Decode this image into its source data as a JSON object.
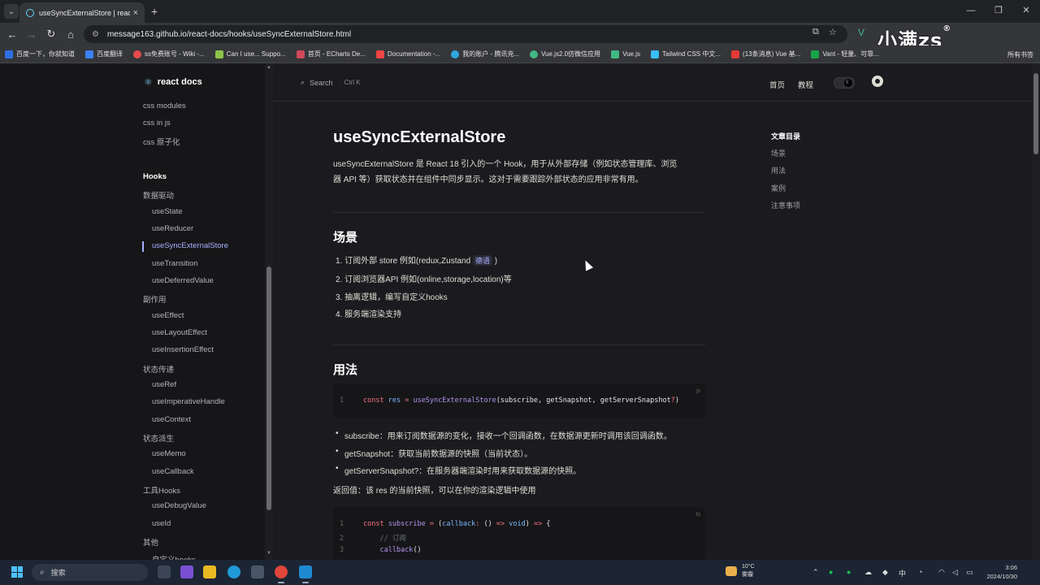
{
  "browser": {
    "tab_title": "useSyncExternalStore | react docs",
    "url": "message163.github.io/react-docs/hooks/useSyncExternalStore.html",
    "bookmarks": [
      "百度一下，你就知道",
      "百度翻译",
      "ss免费账号 - Wiki -...",
      "Can I use... Suppo...",
      "首页 - ECharts De...",
      "Documentation -...",
      "我的账户 - 腾讯充...",
      "Vue.js2.0仿微信应用",
      "Vue.js",
      "Tailwind CSS 中文...",
      "(13条消息) Vue 基...",
      "Vant - 轻量、可靠..."
    ],
    "all_bookmarks": "所有书签",
    "watermark": "小满zs"
  },
  "site": {
    "logo": "react docs",
    "search": "Search",
    "search_key": "Ctrl K",
    "nav_home": "首页",
    "nav_tutorial": "教程"
  },
  "sidebar": {
    "top_items": [
      "css modules",
      "css in js",
      "css 原子化"
    ],
    "hooks_heading": "Hooks",
    "groups": [
      {
        "label": "数据驱动",
        "items": [
          "useState",
          "useReducer",
          "useSyncExternalStore",
          "useTransition",
          "useDeferredValue"
        ]
      },
      {
        "label": "副作用",
        "items": [
          "useEffect",
          "useLayoutEffect",
          "useInsertionEffect"
        ]
      },
      {
        "label": "状态传递",
        "items": [
          "useRef",
          "useImperativeHandle",
          "useContext"
        ]
      },
      {
        "label": "状态派生",
        "items": [
          "useMemo",
          "useCallback"
        ]
      },
      {
        "label": "工具Hooks",
        "items": [
          "useDebugValue",
          "useId"
        ]
      },
      {
        "label": "其他",
        "items": [
          "自定义hooks"
        ]
      }
    ],
    "active": "useSyncExternalStore"
  },
  "article": {
    "title": "useSyncExternalStore",
    "intro_1": "useSyncExternalStore 是 React 18 引入的一个 Hook，用于从外部存储（例如状态管理库、浏览",
    "intro_2": "器 API 等）获取状态并在组件中同步显示。这对于需要跟踪外部状态的应用非常有用。",
    "section_scene": "场景",
    "scene_items": [
      "1. 订阅外部 store 例如(redux,Zustand",
      "2. 订阅浏览器API 例如(online,storage,location)等",
      "3. 抽离逻辑，编写自定义hooks",
      "4. 服务端渲染支持"
    ],
    "scene_badge": "德语",
    "section_usage": "用法",
    "code1_lang": "js",
    "code1_line": "1",
    "bullets": [
      "subscribe：用来订阅数据源的变化，接收一个回调函数，在数据源更新时调用该回调函数。",
      "getSnapshot：获取当前数据源的快照（当前状态）。",
      "getServerSnapshot?：在服务器端渲染时用来获取数据源的快照。"
    ],
    "return_text": "返回值：该 res 的当前快照，可以在你的渲染逻辑中使用",
    "code2_lang": "ts",
    "code2_lines": [
      "1",
      "2",
      "3"
    ]
  },
  "toc": {
    "title": "文章目录",
    "items": [
      "场景",
      "用法",
      "案例",
      "注意事项"
    ]
  },
  "taskbar": {
    "search": "搜索",
    "temp": "10°C",
    "weather": "雾霾",
    "ime": "中",
    "time": "3:06",
    "date": "2024/10/30"
  }
}
